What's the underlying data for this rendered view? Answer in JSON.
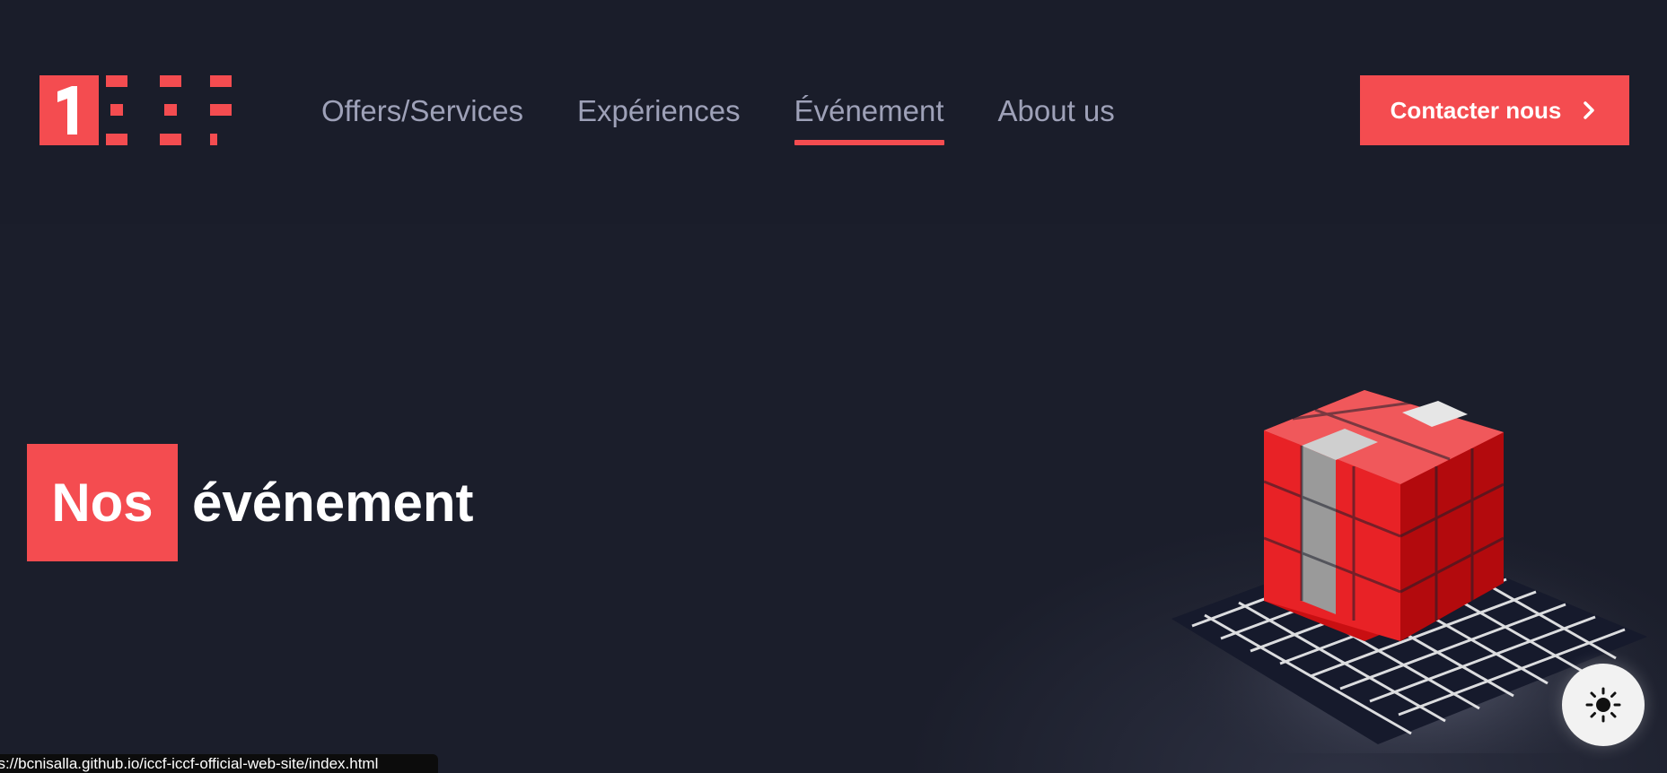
{
  "brand": {
    "logo_name": "1ECF logo",
    "accent_color": "#f44c50"
  },
  "nav": {
    "items": [
      {
        "label": "Offers/Services",
        "active": false
      },
      {
        "label": "Expériences",
        "active": false
      },
      {
        "label": "Événement",
        "active": true
      },
      {
        "label": "About us",
        "active": false
      }
    ]
  },
  "cta": {
    "label": "Contacter nous",
    "icon": "chevron-right-icon"
  },
  "hero": {
    "title_highlight": "Nos",
    "title_rest": "événement"
  },
  "theme_toggle": {
    "icon": "sun-icon"
  },
  "status_bar": {
    "url": "ps://bcnisalla.github.io/iccf-iccf-official-web-site/index.html"
  },
  "colors": {
    "background": "#1b1e2b",
    "nav_text": "#9ea1b8",
    "white": "#ffffff"
  }
}
